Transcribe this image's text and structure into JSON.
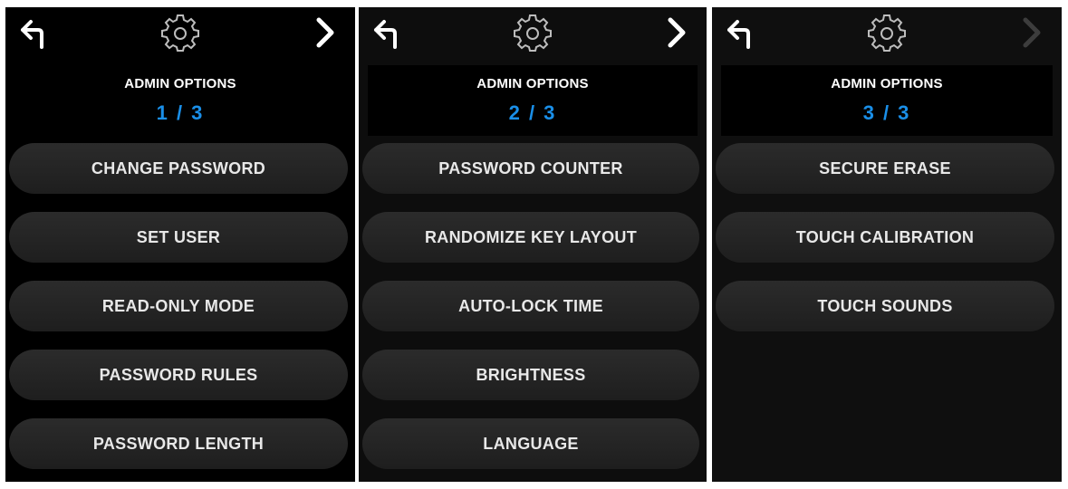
{
  "colors": {
    "page_counter": "#1a8fe8",
    "text": "#ffffff",
    "button_bg": "#262626",
    "disabled_arrow": "#444444"
  },
  "icons": {
    "back": "back-arrow-icon",
    "settings": "gear-icon",
    "next": "chevron-right-icon"
  },
  "screens": [
    {
      "title": "ADMIN OPTIONS",
      "page": "1 / 3",
      "next_enabled": true,
      "items": [
        {
          "label": "CHANGE PASSWORD"
        },
        {
          "label": "SET USER"
        },
        {
          "label": "READ-ONLY MODE"
        },
        {
          "label": "PASSWORD RULES"
        },
        {
          "label": "PASSWORD LENGTH"
        }
      ]
    },
    {
      "title": "ADMIN OPTIONS",
      "page": "2 / 3",
      "next_enabled": true,
      "items": [
        {
          "label": "PASSWORD COUNTER"
        },
        {
          "label": "RANDOMIZE KEY LAYOUT"
        },
        {
          "label": "AUTO-LOCK TIME"
        },
        {
          "label": "BRIGHTNESS"
        },
        {
          "label": "LANGUAGE"
        }
      ]
    },
    {
      "title": "ADMIN OPTIONS",
      "page": "3 / 3",
      "next_enabled": false,
      "items": [
        {
          "label": "SECURE ERASE"
        },
        {
          "label": "TOUCH CALIBRATION"
        },
        {
          "label": "TOUCH SOUNDS"
        }
      ]
    }
  ]
}
